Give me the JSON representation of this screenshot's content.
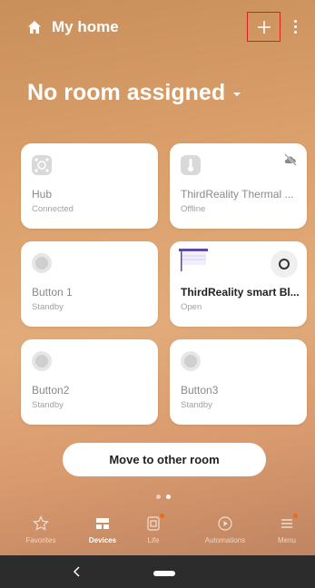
{
  "header": {
    "home_title": "My home",
    "add_icon": "plus-icon",
    "more_icon": "more-vertical-icon"
  },
  "room": {
    "title": "No room assigned"
  },
  "devices": [
    {
      "name": "Hub",
      "status": "Connected",
      "icon": "hub-icon"
    },
    {
      "name": "ThirdReality Thermal ...",
      "status": "Offline",
      "icon": "thermometer-icon"
    },
    {
      "name": "Button 1",
      "status": "Standby",
      "icon": "button-icon"
    },
    {
      "name": "ThirdReality smart Bl...",
      "status": "Open",
      "icon": "blind-icon"
    },
    {
      "name": "Button2",
      "status": "Standby",
      "icon": "button-icon"
    },
    {
      "name": "Button3",
      "status": "Standby",
      "icon": "button-icon"
    }
  ],
  "actions": {
    "move_label": "Move to other room"
  },
  "nav": [
    {
      "label": "Favorites",
      "icon": "star-icon"
    },
    {
      "label": "Devices",
      "icon": "devices-icon"
    },
    {
      "label": "Life",
      "icon": "life-icon"
    },
    {
      "label": "Automations",
      "icon": "play-circle-icon"
    },
    {
      "label": "Menu",
      "icon": "menu-icon"
    }
  ],
  "colors": {
    "accent_badge": "#f06a1e",
    "highlight_box": "#e02020"
  }
}
